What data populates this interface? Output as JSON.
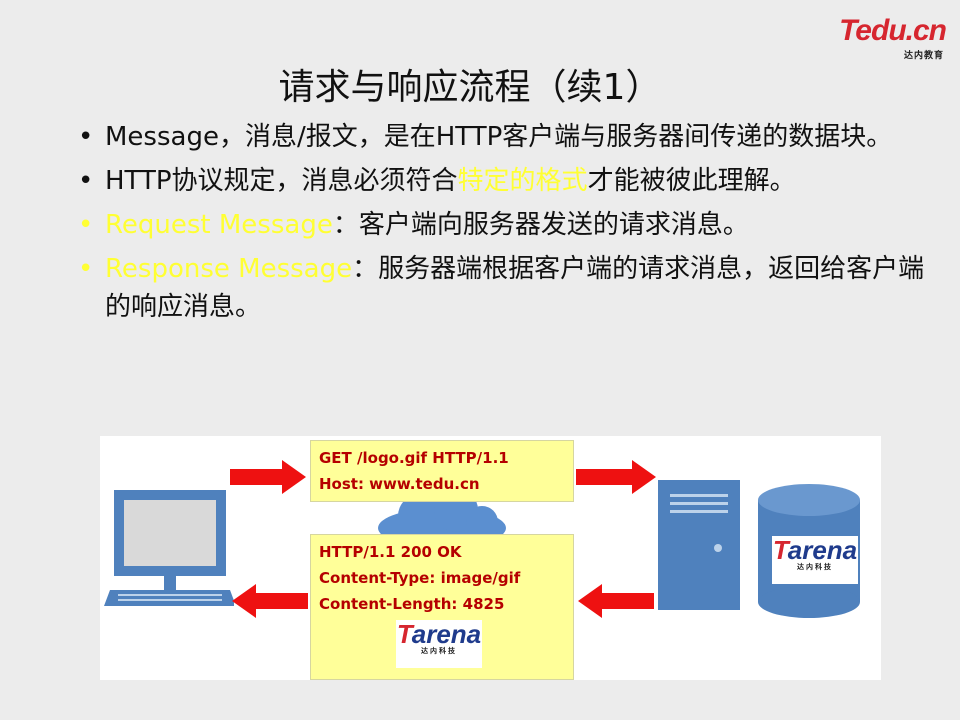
{
  "logo": {
    "brand": "Tedu.cn",
    "sub": "达内教育"
  },
  "title": "请求与响应流程（续1）",
  "bullets": [
    {
      "parts": [
        {
          "text": "Message，消息/报文，是在HTTP客户端与服务器间传递的数据块。",
          "highlight": false
        }
      ]
    },
    {
      "parts": [
        {
          "text": "HTTP协议规定，消息必须符合",
          "highlight": false
        },
        {
          "text": "特定的格式",
          "highlight": true
        },
        {
          "text": "才能被彼此理解。",
          "highlight": false
        }
      ]
    },
    {
      "bullet_highlight": true,
      "parts": [
        {
          "text": "Request Message",
          "highlight": true
        },
        {
          "text": "：客户端向服务器发送的请求消息。",
          "highlight": false
        }
      ]
    },
    {
      "bullet_highlight": true,
      "parts": [
        {
          "text": "Response Message",
          "highlight": true
        },
        {
          "text": "：服务器端根据客户端的请求消息，返回给客户端的响应消息。",
          "highlight": false
        }
      ]
    }
  ],
  "diagram": {
    "request_lines": [
      "GET /logo.gif HTTP/1.1",
      "Host: www.tedu.cn"
    ],
    "response_lines": [
      "HTTP/1.1 200 OK",
      "Content-Type: image/gif",
      "Content-Length: 4825"
    ],
    "arena_logo": {
      "word_f": "T",
      "word_rest": "arena",
      "sub": "达内科技"
    }
  },
  "colors": {
    "highlight": "#ffff33",
    "arrow": "#ee1111",
    "box_fill": "#ffff99",
    "box_text": "#b50000",
    "device_blue": "#4f81bd"
  }
}
